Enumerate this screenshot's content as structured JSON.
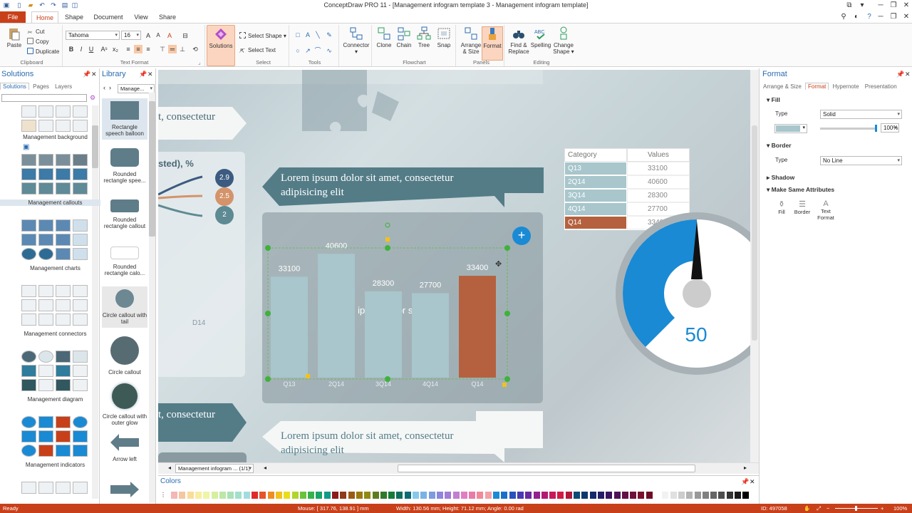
{
  "window": {
    "title": "ConceptDraw PRO 11 - [Management infogram template 3 - Management infogram template]"
  },
  "menu": {
    "file": "File",
    "tabs": [
      "Home",
      "Shape",
      "Document",
      "View",
      "Share"
    ]
  },
  "ribbon": {
    "clipboard": {
      "paste": "Paste",
      "cut": "Cut",
      "copy": "Copy",
      "duplicate": "Duplicate",
      "label": "Clipboard"
    },
    "text_format": {
      "font": "Tahoma",
      "size": "16",
      "label": "Text Format"
    },
    "solutions": "Solutions",
    "select": {
      "select_shape": "Select Shape",
      "select_text": "Select Text",
      "label": "Select"
    },
    "tools_label": "Tools",
    "connector": "Connector",
    "flowchart": {
      "clone": "Clone",
      "chain": "Chain",
      "tree": "Tree",
      "snap": "Snap",
      "label": "Flowchart"
    },
    "panels": {
      "arrange": "Arrange & Size",
      "format": "Format",
      "label": "Panels"
    },
    "editing": {
      "find": "Find & Replace",
      "spelling": "Spelling",
      "change": "Change Shape",
      "label": "Editing"
    }
  },
  "solutions_panel": {
    "title": "Solutions",
    "tabs": [
      "Solutions",
      "Pages",
      "Layers"
    ],
    "groups": [
      "Management background",
      "Management callouts",
      "Management charts",
      "Management connectors",
      "Management diagram",
      "Management indicators"
    ]
  },
  "library_panel": {
    "title": "Library",
    "selector": "Manage...",
    "items": [
      "Rectangle speech balloon",
      "Rounded rectangle spee...",
      "Rounded rectangle callout",
      "Rounded rectangle calo...",
      "Circle callout with tail",
      "Circle callout",
      "Circle callout with outer glow",
      "Arrow left"
    ]
  },
  "canvas": {
    "banner_top": "t, consectetur",
    "pct_label": "sted), %",
    "bubbles": [
      "2.9",
      "2.5",
      "2"
    ],
    "ribbon_text": "Lorem ipsum dolor sit amet, consectetur adipisicing elit",
    "chart_title": "Lorem ipsum dolor sit amet",
    "chart_title_overlap": "40600",
    "d14": "D14",
    "banner_bottom": "t, consectetur",
    "bottom_text": "Lorem ipsum dolor sit amet, consectetur adipisicing elit",
    "table_headers": [
      "Category",
      "Values"
    ],
    "table_rows": [
      [
        "Q13",
        "33100"
      ],
      [
        "2Q14",
        "40600"
      ],
      [
        "3Q14",
        "28300"
      ],
      [
        "4Q14",
        "27700"
      ],
      [
        "Q14",
        "33400"
      ]
    ],
    "gauge_value": "50",
    "add_btn": "+",
    "colors": {
      "bar": "#a8c6cc",
      "bar_highlight": "#b5613f",
      "gauge": "#1a8ad4",
      "banner": "#537c87"
    }
  },
  "chart_data": {
    "type": "bar",
    "categories": [
      "Q13",
      "2Q14",
      "3Q14",
      "4Q14",
      "Q14"
    ],
    "values": [
      33100,
      40600,
      28300,
      27700,
      33400
    ],
    "value_labels": [
      "33100",
      "40600",
      "28300",
      "27700",
      "33400"
    ],
    "title": "Lorem ipsum dolor sit amet",
    "ylim": [
      0,
      43000
    ],
    "highlight_index": 4
  },
  "format_panel": {
    "title": "Format",
    "tabs": [
      "Arrange & Size",
      "Format",
      "Hypernote",
      "Presentation"
    ],
    "fill": "Fill",
    "type_label": "Type",
    "fill_type": "Solid",
    "opacity": "100%",
    "border": "Border",
    "border_type": "No Line",
    "shadow": "Shadow",
    "make_same": "Make Same Attributes",
    "attr_buttons": [
      "Fill",
      "Border",
      "Text Format"
    ]
  },
  "page_tab": "Management infogram ... (1/1)",
  "colors_panel": {
    "title": "Colors"
  },
  "status": {
    "ready": "Ready",
    "mouse": "Mouse: [ 317.76, 138.91 ] mm",
    "size": "Width: 130.56 mm;  Height: 71.12 mm;  Angle: 0.00 rad",
    "id": "ID: 497058",
    "zoom": "100%"
  }
}
